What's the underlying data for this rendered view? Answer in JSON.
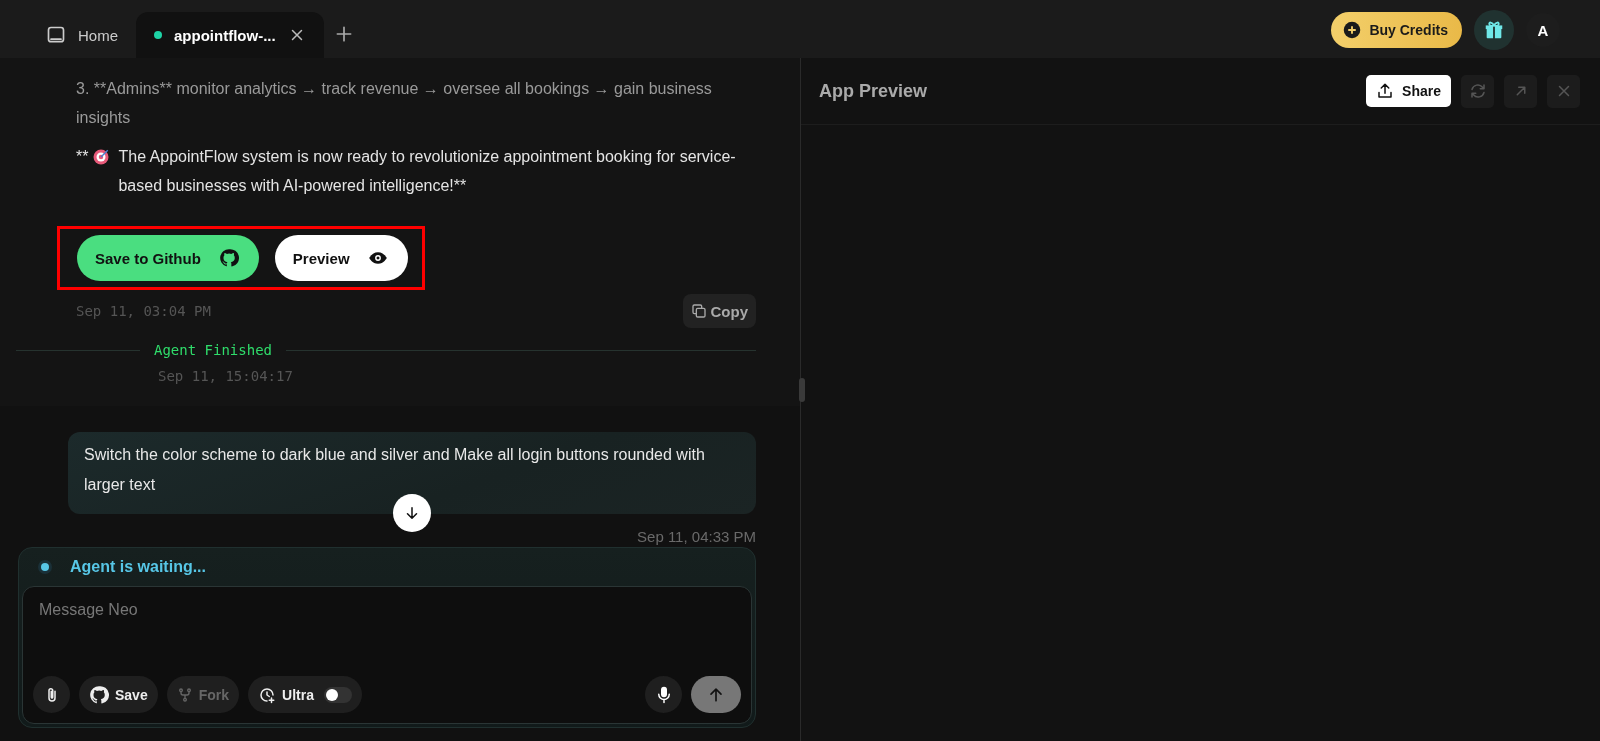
{
  "tabs": [
    {
      "kind": "home",
      "label": "Home",
      "selected": false
    },
    {
      "kind": "project",
      "label": "appointflow-...",
      "selected": true
    }
  ],
  "header": {
    "buy_credits": "Buy Credits",
    "avatar": "A"
  },
  "assistant_message": {
    "list_item": "3. **Admins** monitor analytics → track revenue → oversee all bookings → gain business insights",
    "closing_prefix": "**",
    "closing_text": "The AppointFlow system is now ready to revolutionize appointment booking for service-based businesses with AI-powered intelligence!**",
    "actions_highlighted": true,
    "actions": [
      {
        "kind": "github",
        "label": "Save to Github"
      },
      {
        "kind": "preview",
        "label": "Preview"
      }
    ],
    "timestamp": "Sep 11, 03:04 PM",
    "copy": "Copy"
  },
  "agent_status": {
    "label": "Agent Finished",
    "time": "Sep 11, 15:04:17"
  },
  "user_message": {
    "text": "Switch the color scheme to dark blue and silver and Make all login buttons rounded with larger text",
    "time": "Sep 11, 04:33 PM"
  },
  "composer": {
    "status": "Agent is waiting...",
    "placeholder": "Message Neo",
    "tools": [
      {
        "kind": "attach",
        "disabled": false
      },
      {
        "kind": "save",
        "label": "Save",
        "disabled": false
      },
      {
        "kind": "fork",
        "label": "Fork",
        "disabled": true
      },
      {
        "kind": "ultra",
        "label": "Ultra",
        "disabled": false,
        "on": false
      }
    ]
  },
  "preview": {
    "title": "App Preview",
    "share": "Share"
  }
}
